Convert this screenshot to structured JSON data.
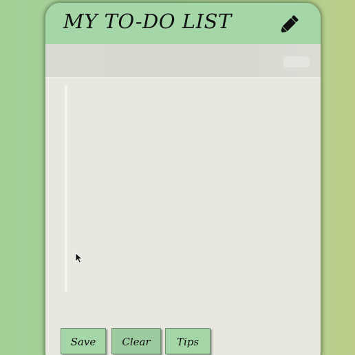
{
  "app": {
    "title": "MY TO-DO LIST"
  },
  "header": {
    "edit_icon": "pencil-icon"
  },
  "input": {
    "value": "",
    "placeholder": ""
  },
  "tasks": [],
  "footer": {
    "save_label": "Save",
    "clear_label": "Clear",
    "tips_label": "Tips"
  },
  "colors": {
    "accent": "#a4d6a7",
    "card": "#e8e8e0",
    "background": "#a9d199"
  }
}
